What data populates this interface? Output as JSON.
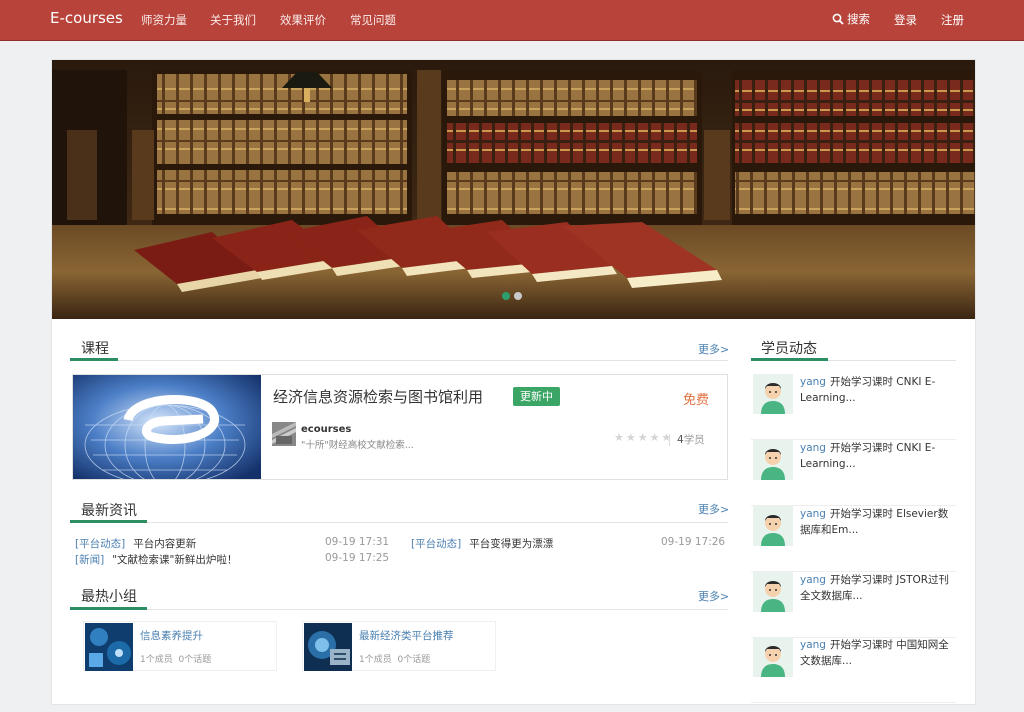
{
  "nav": {
    "brand": "E-courses",
    "items": [
      "师资力量",
      "关于我们",
      "效果评价",
      "常见问题"
    ],
    "search": "搜索",
    "login": "登录",
    "register": "注册"
  },
  "courses": {
    "title": "课程",
    "more": "更多>",
    "item": {
      "title": "经济信息资源检索与图书馆利用",
      "badge": "更新中",
      "price": "免费",
      "org_name": "ecourses",
      "org_desc": "\"十所\"财经高校文献检索...",
      "rating": 0,
      "rating_max": 5,
      "students": "4",
      "students_unit": "学员"
    }
  },
  "news": {
    "title": "最新资讯",
    "more": "更多>",
    "items": [
      {
        "tag": "[平台动态]",
        "text": "平台内容更新",
        "time": "09-19 17:31"
      },
      {
        "tag": "[平台动态]",
        "text": "平台变得更为漂漂",
        "time": "09-19 17:26"
      },
      {
        "tag": "[新闻]",
        "text": "\"文献检索课\"新鲜出炉啦！",
        "time": "09-19 17:25"
      }
    ]
  },
  "groups": {
    "title": "最热小组",
    "more": "更多>",
    "items": [
      {
        "name": "信息素养提升",
        "members": "1个成员",
        "topics": "0个话题"
      },
      {
        "name": "最新经济类平台推荐",
        "members": "1个成员",
        "topics": "0个话题"
      }
    ]
  },
  "activity": {
    "title": "学员动态",
    "items": [
      {
        "user": "yang",
        "text": "开始学习课时 CNKI E-Learning..."
      },
      {
        "user": "yang",
        "text": "开始学习课时 CNKI E-Learning..."
      },
      {
        "user": "yang",
        "text": "开始学习课时 Elsevier数据库和Em..."
      },
      {
        "user": "yang",
        "text": "开始学习课时 JSTOR过刊全文数据库..."
      },
      {
        "user": "yang",
        "text": "开始学习课时 中国知网全文数据库..."
      }
    ]
  },
  "banner": {
    "slides": 2,
    "active_slide": 1
  },
  "colors": {
    "nav_bg": "#b8433a",
    "accent": "#2b8f63",
    "badge": "#3aa565",
    "link": "#4a7fb0",
    "price": "#e2713f"
  }
}
